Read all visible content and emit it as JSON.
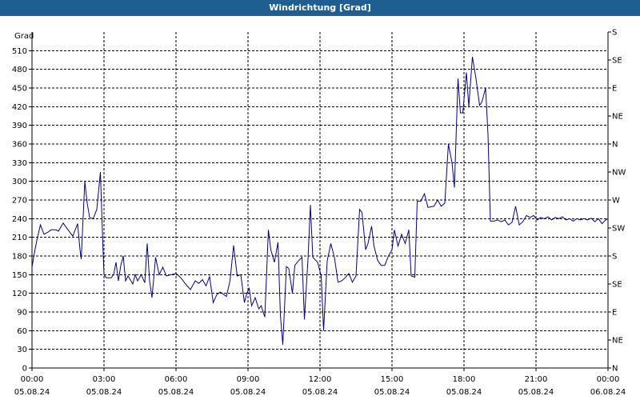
{
  "window": {
    "title": "Windrichtung [Grad]"
  },
  "chart_data": {
    "type": "line",
    "title": "Windrichtung [Grad]",
    "ylabel": "Grad",
    "ylim": [
      0,
      540
    ],
    "yticks": [
      0,
      30,
      60,
      90,
      120,
      150,
      180,
      210,
      240,
      270,
      300,
      330,
      360,
      390,
      420,
      450,
      480,
      510
    ],
    "right_axis_labels": [
      "N",
      "NE",
      "E",
      "SE",
      "S",
      "SW",
      "W",
      "NW",
      "N",
      "NE",
      "E",
      "SE",
      "S"
    ],
    "right_axis_values": [
      0,
      45,
      90,
      135,
      180,
      225,
      270,
      315,
      360,
      405,
      450,
      495,
      540
    ],
    "xlim": [
      0,
      24
    ],
    "xticks": [
      {
        "time": "00:00",
        "date": "05.08.24"
      },
      {
        "time": "03:00",
        "date": "05.08.24"
      },
      {
        "time": "06:00",
        "date": "05.08.24"
      },
      {
        "time": "09:00",
        "date": "05.08.24"
      },
      {
        "time": "12:00",
        "date": "05.08.24"
      },
      {
        "time": "15:00",
        "date": "05.08.24"
      },
      {
        "time": "18:00",
        "date": "05.08.24"
      },
      {
        "time": "21:00",
        "date": "05.08.24"
      },
      {
        "time": "00:00",
        "date": "06.08.24"
      }
    ],
    "grid": true,
    "series": [
      {
        "color": "#00008b",
        "points": [
          [
            0.0,
            162
          ],
          [
            0.1,
            185
          ],
          [
            0.2,
            205
          ],
          [
            0.35,
            230
          ],
          [
            0.5,
            215
          ],
          [
            0.65,
            218
          ],
          [
            0.8,
            222
          ],
          [
            1.0,
            222
          ],
          [
            1.1,
            220
          ],
          [
            1.3,
            233
          ],
          [
            1.5,
            222
          ],
          [
            1.7,
            212
          ],
          [
            1.9,
            232
          ],
          [
            2.0,
            190
          ],
          [
            2.05,
            175
          ],
          [
            2.2,
            300
          ],
          [
            2.3,
            265
          ],
          [
            2.4,
            242
          ],
          [
            2.55,
            240
          ],
          [
            2.7,
            255
          ],
          [
            2.85,
            315
          ],
          [
            2.95,
            200
          ],
          [
            3.0,
            150
          ],
          [
            3.1,
            145
          ],
          [
            3.3,
            145
          ],
          [
            3.4,
            150
          ],
          [
            3.5,
            170
          ],
          [
            3.6,
            140
          ],
          [
            3.7,
            165
          ],
          [
            3.8,
            180
          ],
          [
            3.9,
            140
          ],
          [
            4.0,
            148
          ],
          [
            4.2,
            135
          ],
          [
            4.3,
            150
          ],
          [
            4.4,
            140
          ],
          [
            4.55,
            150
          ],
          [
            4.7,
            137
          ],
          [
            4.8,
            200
          ],
          [
            4.9,
            140
          ],
          [
            5.0,
            113
          ],
          [
            5.15,
            178
          ],
          [
            5.3,
            150
          ],
          [
            5.45,
            162
          ],
          [
            5.6,
            148
          ],
          [
            5.8,
            150
          ],
          [
            6.0,
            152
          ],
          [
            6.2,
            145
          ],
          [
            6.4,
            135
          ],
          [
            6.6,
            126
          ],
          [
            6.8,
            140
          ],
          [
            6.95,
            136
          ],
          [
            7.1,
            142
          ],
          [
            7.25,
            132
          ],
          [
            7.4,
            147
          ],
          [
            7.55,
            105
          ],
          [
            7.7,
            118
          ],
          [
            7.85,
            122
          ],
          [
            8.0,
            118
          ],
          [
            8.1,
            115
          ],
          [
            8.25,
            140
          ],
          [
            8.4,
            197
          ],
          [
            8.55,
            148
          ],
          [
            8.7,
            150
          ],
          [
            8.85,
            105
          ],
          [
            8.95,
            120
          ],
          [
            9.05,
            128
          ],
          [
            9.15,
            100
          ],
          [
            9.3,
            113
          ],
          [
            9.45,
            95
          ],
          [
            9.55,
            100
          ],
          [
            9.7,
            82
          ],
          [
            9.85,
            222
          ],
          [
            9.95,
            190
          ],
          [
            10.1,
            170
          ],
          [
            10.25,
            202
          ],
          [
            10.35,
            85
          ],
          [
            10.45,
            37
          ],
          [
            10.6,
            163
          ],
          [
            10.7,
            160
          ],
          [
            10.85,
            120
          ],
          [
            10.95,
            165
          ],
          [
            11.1,
            172
          ],
          [
            11.25,
            178
          ],
          [
            11.35,
            78
          ],
          [
            11.5,
            175
          ],
          [
            11.6,
            262
          ],
          [
            11.7,
            178
          ],
          [
            11.9,
            170
          ],
          [
            12.05,
            148
          ],
          [
            12.15,
            60
          ],
          [
            12.3,
            172
          ],
          [
            12.45,
            200
          ],
          [
            12.6,
            178
          ],
          [
            12.75,
            138
          ],
          [
            12.9,
            140
          ],
          [
            13.05,
            145
          ],
          [
            13.2,
            152
          ],
          [
            13.35,
            138
          ],
          [
            13.5,
            148
          ],
          [
            13.65,
            255
          ],
          [
            13.75,
            250
          ],
          [
            13.9,
            190
          ],
          [
            14.0,
            200
          ],
          [
            14.15,
            228
          ],
          [
            14.25,
            196
          ],
          [
            14.4,
            173
          ],
          [
            14.55,
            165
          ],
          [
            14.7,
            165
          ],
          [
            14.85,
            180
          ],
          [
            15.0,
            190
          ],
          [
            15.1,
            222
          ],
          [
            15.25,
            196
          ],
          [
            15.4,
            215
          ],
          [
            15.55,
            200
          ],
          [
            15.7,
            222
          ],
          [
            15.8,
            148
          ],
          [
            15.95,
            146
          ],
          [
            16.05,
            268
          ],
          [
            16.2,
            268
          ],
          [
            16.35,
            280
          ],
          [
            16.5,
            258
          ],
          [
            16.6,
            259
          ],
          [
            16.75,
            260
          ],
          [
            16.9,
            270
          ],
          [
            17.05,
            260
          ],
          [
            17.2,
            265
          ],
          [
            17.35,
            360
          ],
          [
            17.5,
            330
          ],
          [
            17.6,
            290
          ],
          [
            17.75,
            465
          ],
          [
            17.85,
            410
          ],
          [
            17.95,
            410
          ],
          [
            18.1,
            475
          ],
          [
            18.2,
            420
          ],
          [
            18.35,
            500
          ],
          [
            18.5,
            465
          ],
          [
            18.65,
            422
          ],
          [
            18.75,
            428
          ],
          [
            18.9,
            450
          ],
          [
            19.0,
            375
          ],
          [
            19.1,
            236
          ],
          [
            19.25,
            236
          ],
          [
            19.4,
            238
          ],
          [
            19.55,
            235
          ],
          [
            19.7,
            238
          ],
          [
            19.85,
            230
          ],
          [
            20.0,
            234
          ],
          [
            20.15,
            260
          ],
          [
            20.3,
            230
          ],
          [
            20.45,
            235
          ],
          [
            20.6,
            245
          ],
          [
            20.75,
            242
          ],
          [
            20.9,
            245
          ],
          [
            21.05,
            238
          ],
          [
            21.2,
            242
          ],
          [
            21.35,
            240
          ],
          [
            21.5,
            243
          ],
          [
            21.65,
            238
          ],
          [
            21.8,
            242
          ],
          [
            21.95,
            240
          ],
          [
            22.1,
            243
          ],
          [
            22.25,
            238
          ],
          [
            22.4,
            240
          ],
          [
            22.55,
            236
          ],
          [
            22.7,
            240
          ],
          [
            22.85,
            238
          ],
          [
            23.0,
            240
          ],
          [
            23.15,
            238
          ],
          [
            23.3,
            241
          ],
          [
            23.45,
            235
          ],
          [
            23.6,
            240
          ],
          [
            23.75,
            232
          ],
          [
            23.9,
            238
          ],
          [
            24.0,
            240
          ]
        ]
      }
    ]
  }
}
